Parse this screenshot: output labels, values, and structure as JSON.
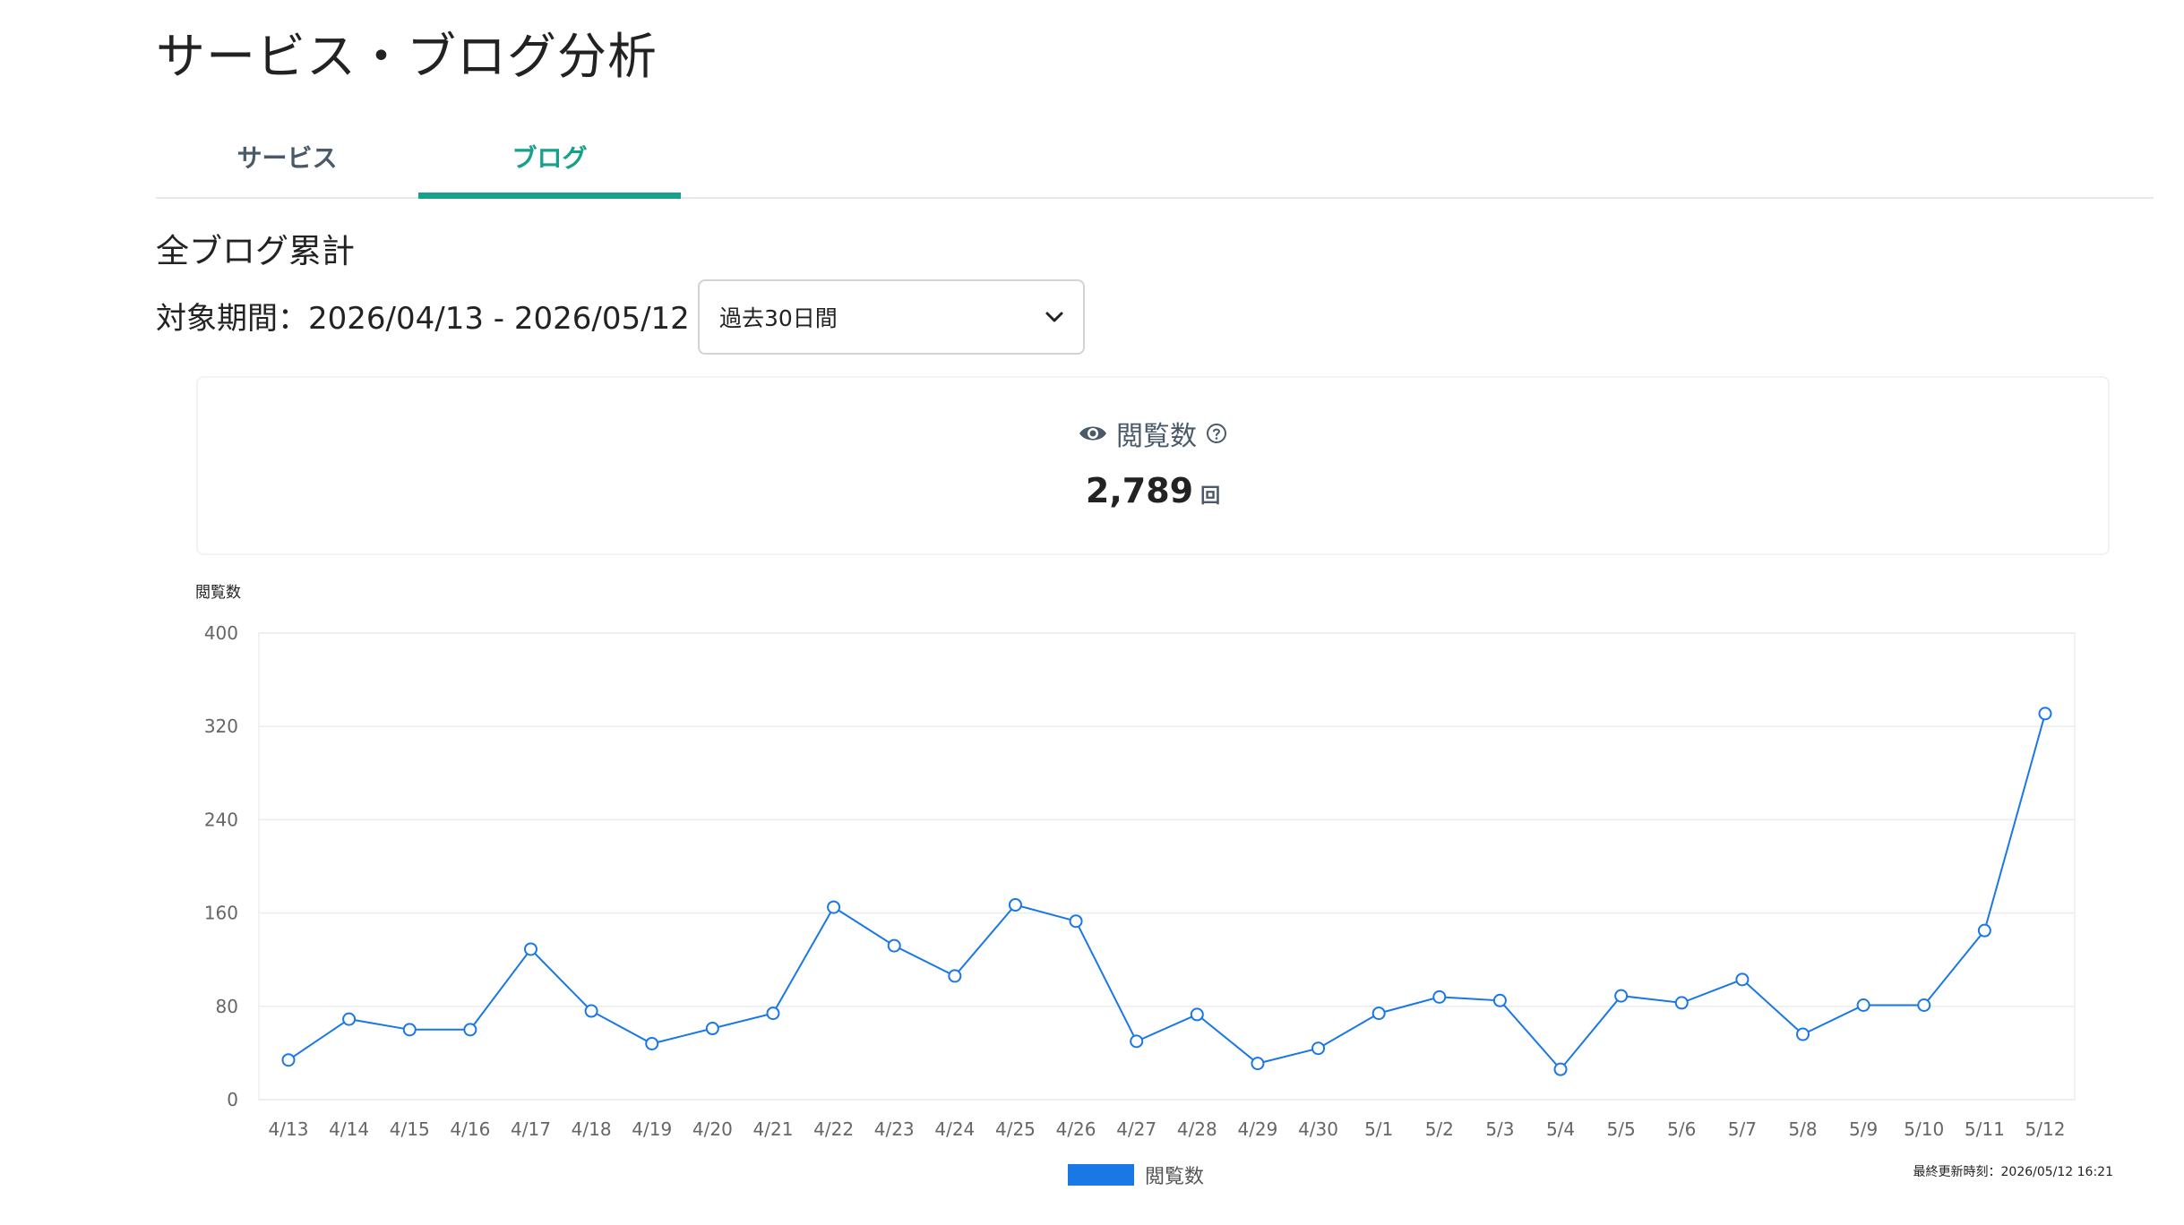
{
  "page": {
    "title": "サービス・ブログ分析"
  },
  "tabs": [
    {
      "label": "サービス",
      "active": false
    },
    {
      "label": "ブログ",
      "active": true
    }
  ],
  "section": {
    "title": "全ブログ累計",
    "period": "対象期間：2026/04/13 - 2026/05/12",
    "period_select": {
      "value": "過去30日間"
    }
  },
  "summary": {
    "icon": "eye-icon",
    "label": "閲覧数",
    "help_icon": "help-circle-icon",
    "value": "2,789",
    "unit": "回"
  },
  "colors": {
    "accent": "#17a08a",
    "series": "#1a77e6"
  },
  "chart_data": {
    "type": "line",
    "ylabel": "閲覧数",
    "ylim": [
      0,
      400
    ],
    "yticks": [
      "0",
      "80",
      "160",
      "240",
      "320",
      "400"
    ],
    "categories": [
      "4/13",
      "4/14",
      "4/15",
      "4/16",
      "4/17",
      "4/18",
      "4/19",
      "4/20",
      "4/21",
      "4/22",
      "4/23",
      "4/24",
      "4/25",
      "4/26",
      "4/27",
      "4/28",
      "4/29",
      "4/30",
      "5/1",
      "5/2",
      "5/3",
      "5/4",
      "5/5",
      "5/6",
      "5/7",
      "5/8",
      "5/9",
      "5/10",
      "5/11",
      "5/12"
    ],
    "series": [
      {
        "name": "閲覧数",
        "values": [
          34,
          69,
          60,
          60,
          129,
          76,
          48,
          61,
          74,
          165,
          132,
          106,
          167,
          153,
          50,
          73,
          31,
          44,
          74,
          88,
          85,
          26,
          89,
          83,
          103,
          56,
          81,
          81,
          145,
          331
        ]
      }
    ],
    "grid": true,
    "legend": "bottom-center"
  },
  "footer": {
    "last_updated": "最終更新時刻：2026/05/12 16:21"
  }
}
